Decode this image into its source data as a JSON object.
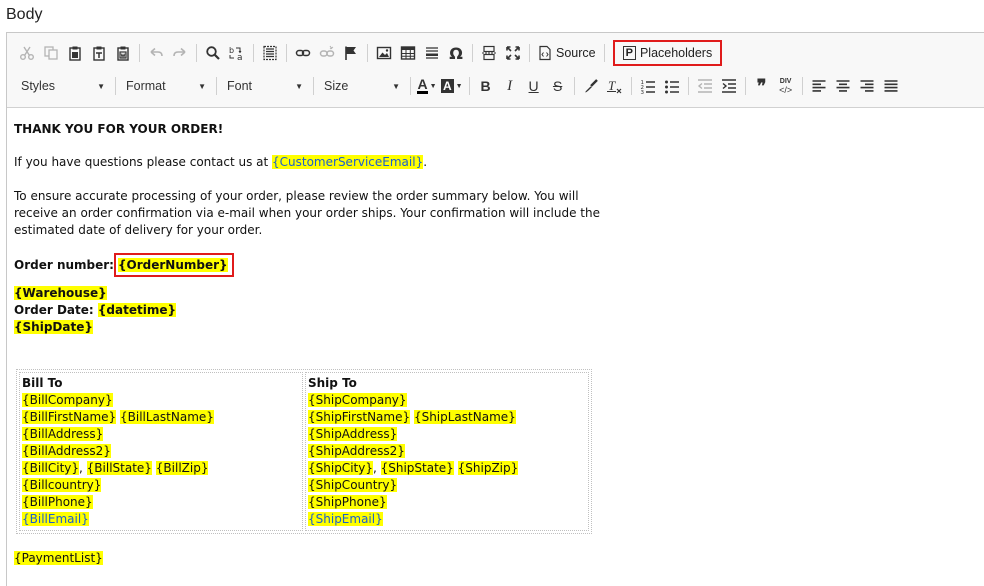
{
  "field_label": "Body",
  "toolbar": {
    "source_label": "Source",
    "placeholders_label": "Placeholders",
    "styles_label": "Styles",
    "format_label": "Format",
    "font_label": "Font",
    "size_label": "Size",
    "placeholder_marker": "P",
    "omega_glyph": "Ω",
    "bold_glyph": "B",
    "italic_glyph": "I",
    "underline_glyph": "U",
    "strike_glyph": "S",
    "quote_glyph": "❞",
    "text_color_glyph": "A",
    "bg_color_glyph": "A",
    "div_glyph": "DIV",
    "text_color": "#000000",
    "highlight_color": "#ffff00",
    "outline_color": "#e01b1b"
  },
  "content": {
    "heading": "THANK YOU FOR YOUR ORDER!",
    "contact_prefix": "If you have questions please contact us at ",
    "contact_token": "{CustomerServiceEmail}",
    "contact_suffix": ".",
    "para_line1": "To ensure accurate processing of your order, please review the order summary below. You will",
    "para_line2": "receive an order confirmation via e-mail when your order ships. Your confirmation will include the",
    "para_line3": "estimated date of delivery for your order.",
    "order_number_label": "Order number:",
    "order_number_token": "{OrderNumber}",
    "warehouse_token": "{Warehouse}",
    "order_date_label": "Order Date: ",
    "datetime_token": "{datetime}",
    "shipdate_token": "{ShipDate}",
    "payment_token": "{PaymentList}"
  },
  "bill": {
    "header": "Bill To",
    "company": "{BillCompany}",
    "first_name": "{BillFirstName}",
    "last_name": "{BillLastName}",
    "address": "{BillAddress}",
    "address2": "{BillAddress2}",
    "city": "{BillCity}",
    "state": "{BillState}",
    "zip": "{BillZip}",
    "country": "{Billcountry}",
    "phone": "{BillPhone}",
    "email": "{BillEmail}"
  },
  "ship": {
    "header": "Ship To",
    "company": "{ShipCompany}",
    "first_name": "{ShipFirstName}",
    "last_name": "{ShipLastName}",
    "address": "{ShipAddress}",
    "address2": "{ShipAddress2}",
    "city": "{ShipCity}",
    "state": "{ShipState}",
    "zip": "{ShipZip}",
    "country": "{ShipCountry}",
    "phone": "{ShipPhone}",
    "email": "{ShipEmail}"
  },
  "separators": {
    "space": " ",
    "comma": ", "
  }
}
